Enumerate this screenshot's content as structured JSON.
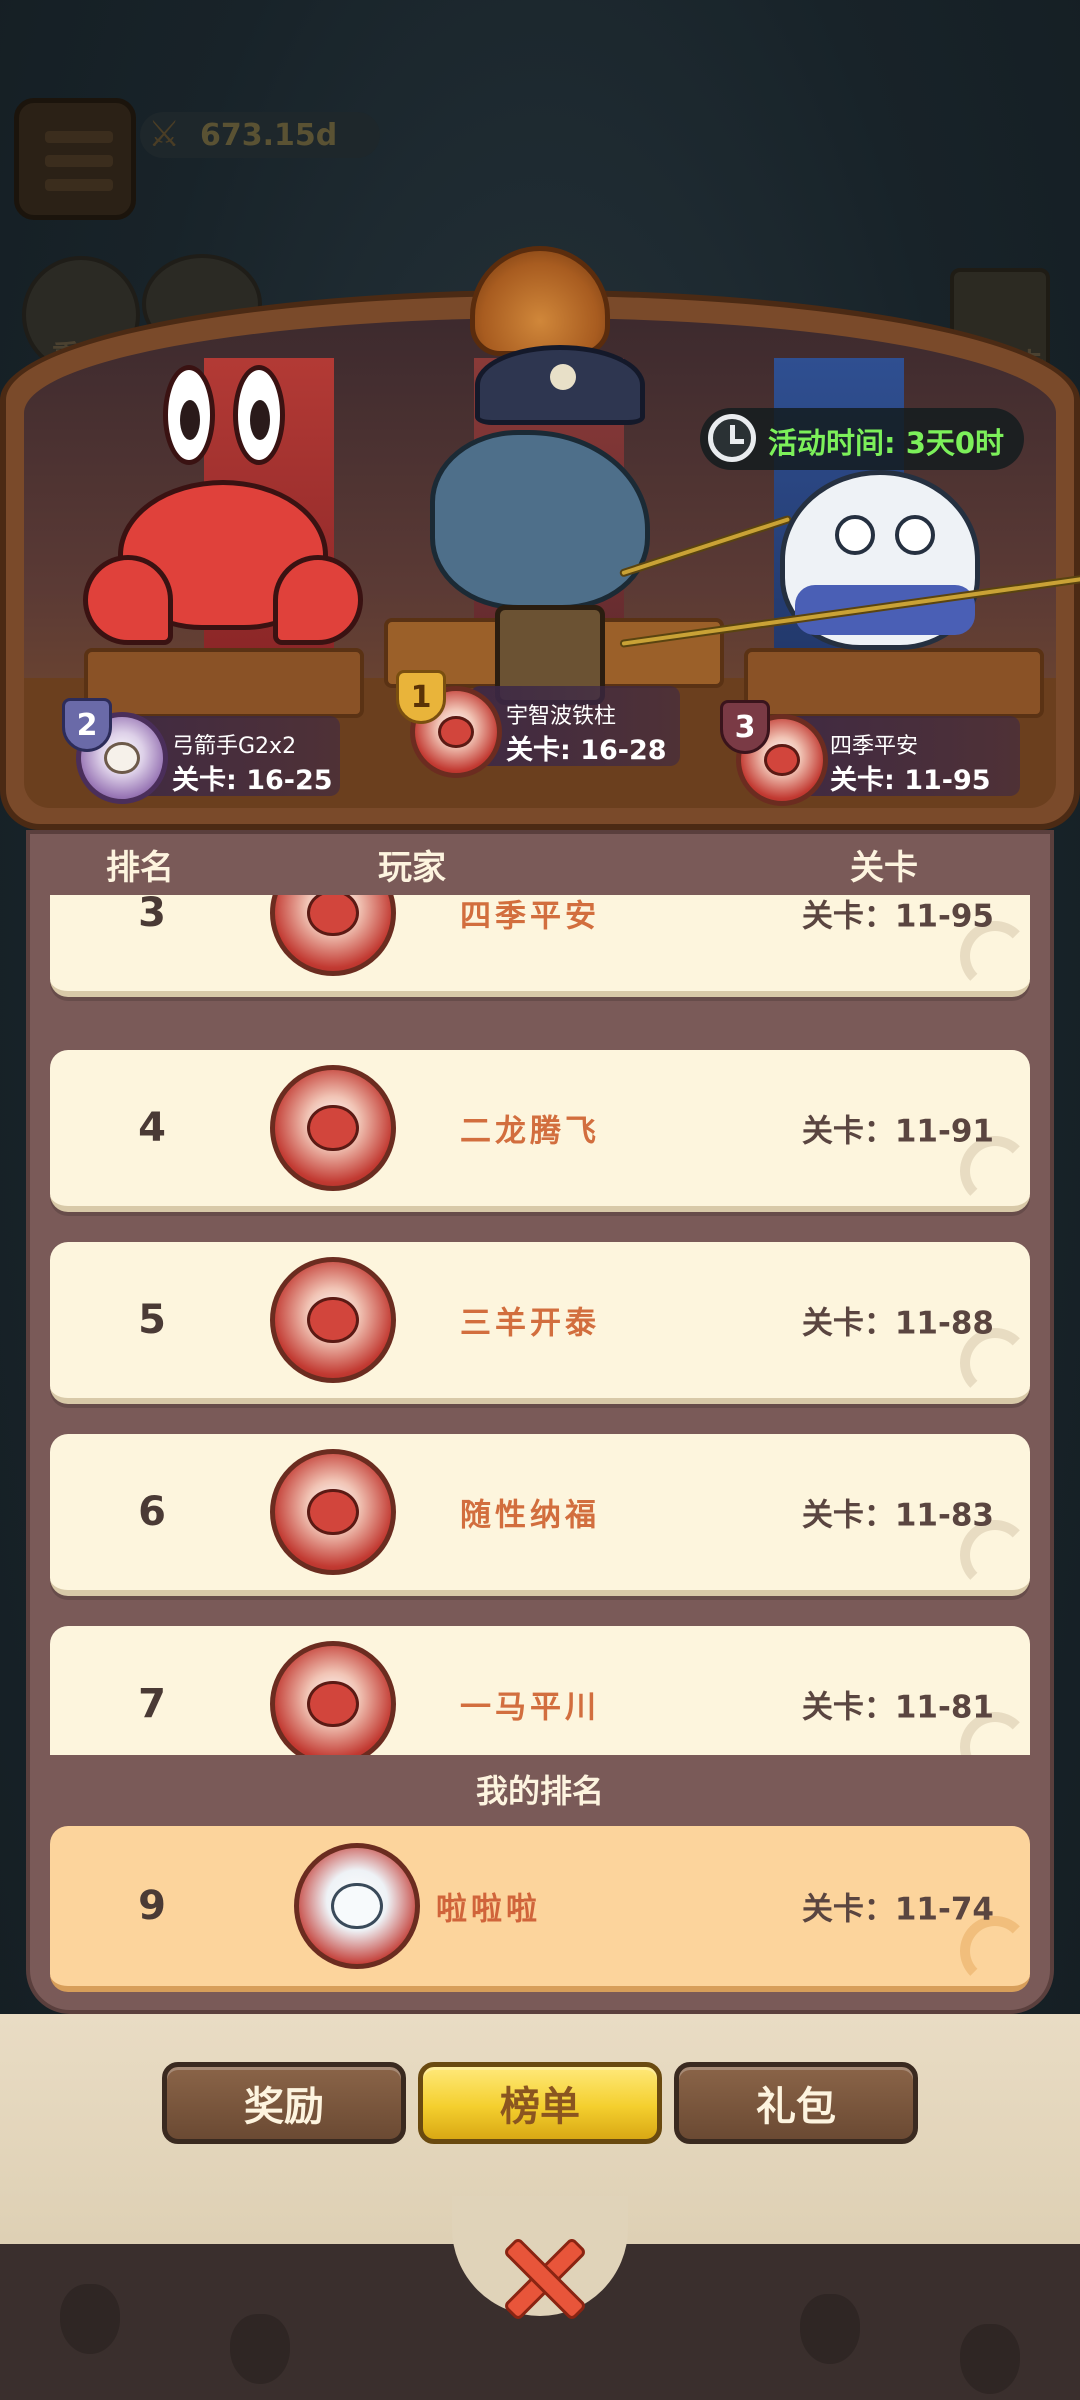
{
  "hud": {
    "power_value": "673.15d",
    "side_icon_left_label": "重生",
    "side_icon_right_label": "特权卡"
  },
  "event": {
    "timer_label": "活动时间: 3天0时"
  },
  "podium": [
    {
      "rank": "2",
      "name": "弓箭手G2x2",
      "stage": "关卡: 16-25"
    },
    {
      "rank": "1",
      "name": "宇智波铁柱",
      "stage": "关卡: 16-28"
    },
    {
      "rank": "3",
      "name": "四季平安",
      "stage": "关卡: 11-95"
    }
  ],
  "table": {
    "headers": [
      "排名",
      "玩家",
      "关卡"
    ],
    "rows": [
      {
        "rank": "3",
        "name": "四季平安",
        "stage": "关卡：11-95"
      },
      {
        "rank": "4",
        "name": "二龙腾飞",
        "stage": "关卡：11-91"
      },
      {
        "rank": "5",
        "name": "三羊开泰",
        "stage": "关卡：11-88"
      },
      {
        "rank": "6",
        "name": "随性纳福",
        "stage": "关卡：11-83"
      },
      {
        "rank": "7",
        "name": "一马平川",
        "stage": "关卡：11-81"
      }
    ]
  },
  "my_rank": {
    "title": "我的排名",
    "rank": "9",
    "name": "啦啦啦",
    "stage": "关卡：11-74"
  },
  "tabs": [
    {
      "label": "奖励",
      "active": false
    },
    {
      "label": "榜单",
      "active": true
    },
    {
      "label": "礼包",
      "active": false
    }
  ],
  "colors": {
    "timer_text": "#7cf05a",
    "player_name": "#d26e3e",
    "active_tab": "#f4cf2e"
  },
  "icons": [
    "menu-icon",
    "sword-icon",
    "clock-icon",
    "close-icon",
    "swirl-icon"
  ]
}
